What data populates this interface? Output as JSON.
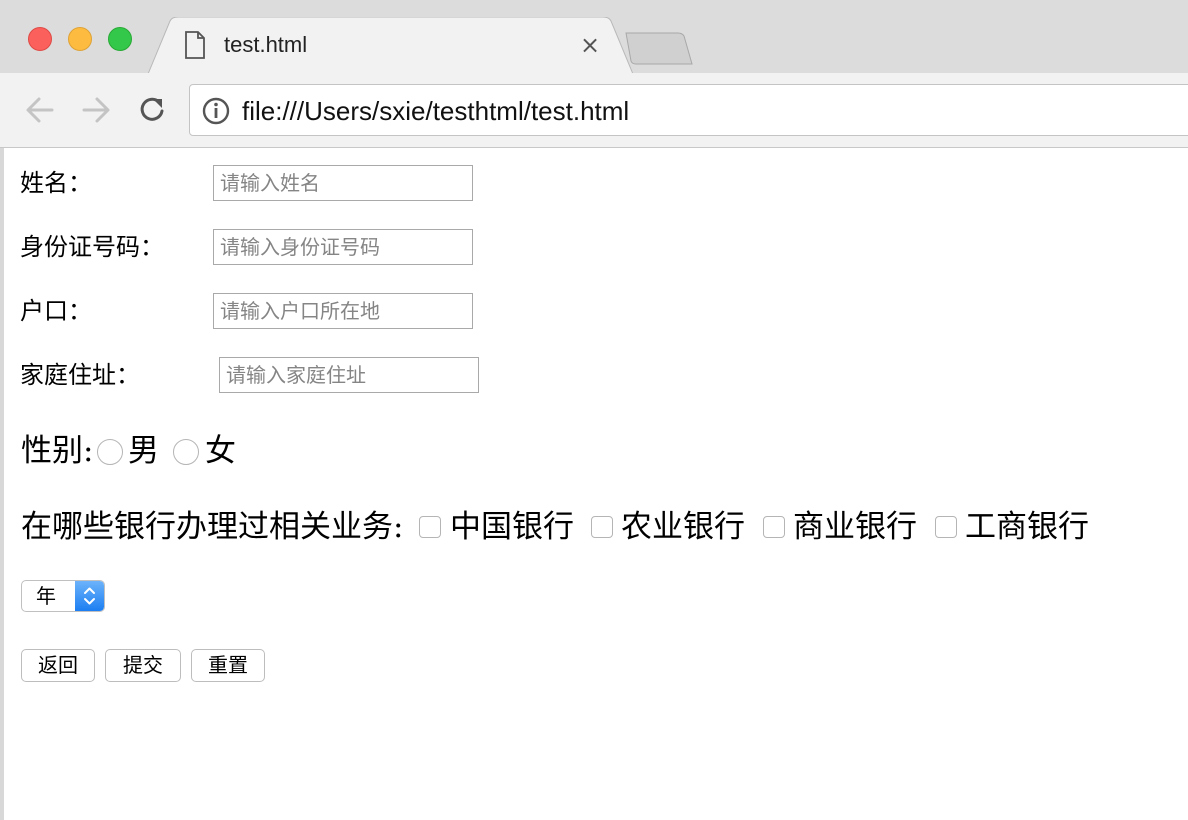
{
  "browser": {
    "tab_title": "test.html",
    "url": "file:///Users/sxie/testhtml/test.html"
  },
  "form": {
    "fields": [
      {
        "label": "姓名：",
        "placeholder": "请输入姓名",
        "value": ""
      },
      {
        "label": "身份证号码：",
        "placeholder": "请输入身份证号码",
        "value": ""
      },
      {
        "label": "户口：",
        "placeholder": "请输入户口所在地",
        "value": ""
      },
      {
        "label": "家庭住址：",
        "placeholder": "请输入家庭住址",
        "value": ""
      }
    ],
    "gender": {
      "label": "性别:",
      "options": [
        {
          "label": "男",
          "checked": false
        },
        {
          "label": "女",
          "checked": false
        }
      ]
    },
    "banks": {
      "label": "在哪些银行办理过相关业务:",
      "options": [
        {
          "label": "中国银行",
          "checked": false
        },
        {
          "label": "农业银行",
          "checked": false
        },
        {
          "label": "商业银行",
          "checked": false
        },
        {
          "label": "工商银行",
          "checked": false
        }
      ]
    },
    "year_select": {
      "selected": "年"
    },
    "buttons": {
      "back": "返回",
      "submit": "提交",
      "reset": "重置"
    }
  },
  "colors": {
    "close_red": "#fc605c",
    "minimize_yellow": "#fdbc40",
    "zoom_green": "#34c84a",
    "select_accent": "#1c7ef2"
  }
}
